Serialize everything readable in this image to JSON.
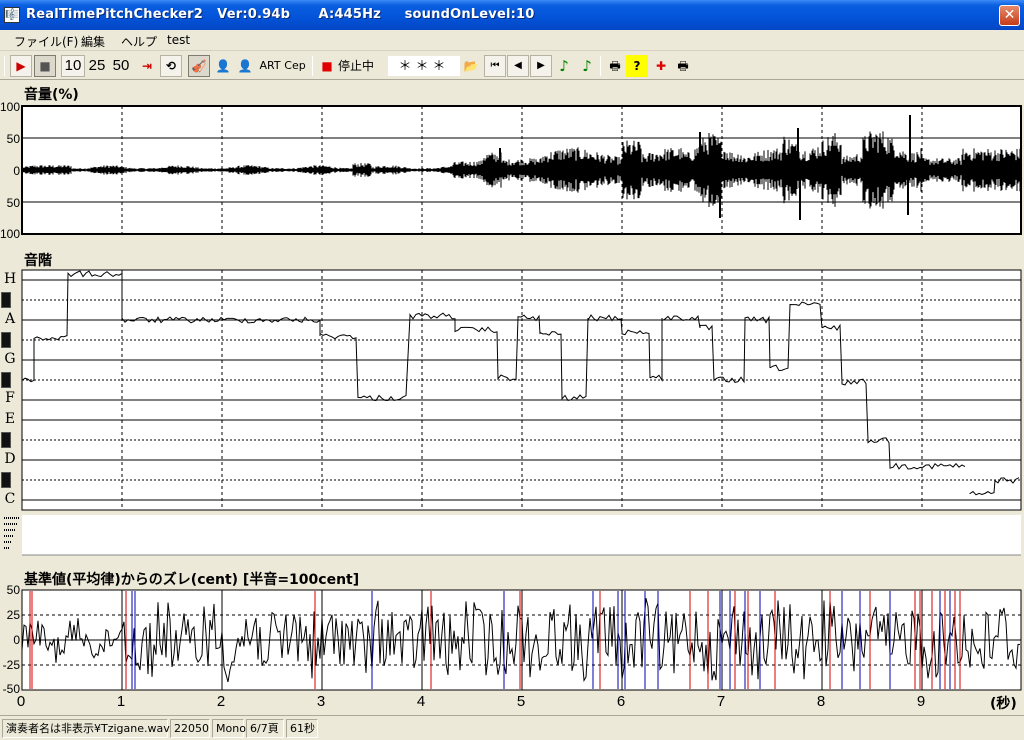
{
  "window": {
    "title": "RealTimePitchChecker2   Ver:0.94b      A:445Hz     soundOnLevel:10",
    "app_icon": "🎼",
    "close_glyph": "✕"
  },
  "menu": [
    "ファイル(F)",
    "編集",
    "ヘルプ",
    "test"
  ],
  "toolbar": {
    "play": "▶",
    "stop": "■",
    "speed_10": "10",
    "speed_25": "25",
    "speed_50": "50",
    "goto_end": "⇥",
    "loop": "⟲",
    "violin": "🎻",
    "player_dark": "👤",
    "player_red": "👤",
    "art": "ART",
    "cep": "Cep",
    "status_dot": "■",
    "status_label": "停止中",
    "note_display": "＊＊＊",
    "open": "📂",
    "first": "⏮",
    "prev": "◀",
    "next": "▶",
    "note1": "♪",
    "note2": "♪",
    "print": "🖶",
    "help": "?",
    "marker": "✚",
    "print2": "🖶",
    "colors": {
      "play": "#cc0000",
      "stop_dot": "#e00000",
      "note": "#008000"
    }
  },
  "volume_panel": {
    "label": "音量(%)",
    "ticks": [
      "100",
      "50",
      "0",
      "50",
      "100"
    ]
  },
  "pitch_panel": {
    "label": "音階",
    "notes": [
      "H",
      "A",
      "G",
      "F",
      "E",
      "D",
      "C"
    ]
  },
  "cent_panel": {
    "label": "基準値(平均律)からのズレ(cent) [半音=100cent]",
    "ticks": [
      "50",
      "25",
      "0",
      "-25",
      "-50"
    ]
  },
  "time_axis": {
    "ticks": [
      "0",
      "1",
      "2",
      "3",
      "4",
      "5",
      "6",
      "7",
      "8",
      "9"
    ],
    "unit": "(秒)"
  },
  "statusbar": {
    "file": "演奏者名は非表示¥Tzigane.wav",
    "rate": "22050",
    "channels": "Mono",
    "page": "6/7頁",
    "duration": "61秒"
  }
}
